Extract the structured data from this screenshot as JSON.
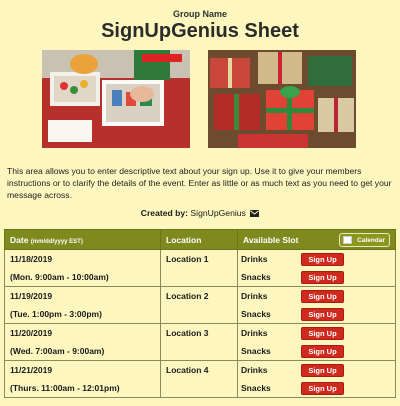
{
  "header": {
    "group_name": "Group Name",
    "title": "SignUpGenius Sheet"
  },
  "description": "This area allows you to enter descriptive text about your sign up. Use it to give your members instructions or to clarify the details of the event. Enter as little or as much text as you need to get your message across.",
  "created_by": {
    "label": "Created by:",
    "name": "SignUpGenius"
  },
  "table": {
    "col_date": "Date",
    "col_date_format": "(mm/dd/yyyy EST)",
    "col_location": "Location",
    "col_slot": "Available Slot",
    "calendar_label": "Calendar",
    "rows": [
      {
        "date": "11/18/2019",
        "time": "(Mon. 9:00am - 10:00am)",
        "location": "Location 1",
        "slots": [
          {
            "name": "Drinks",
            "button": "Sign Up"
          },
          {
            "name": "Snacks",
            "button": "Sign Up"
          }
        ]
      },
      {
        "date": "11/19/2019",
        "time": "(Tue. 1:00pm - 3:00pm)",
        "location": "Location 2",
        "slots": [
          {
            "name": "Drinks",
            "button": "Sign Up"
          },
          {
            "name": "Snacks",
            "button": "Sign Up"
          }
        ]
      },
      {
        "date": "11/20/2019",
        "time": "(Wed. 7:00am - 9:00am)",
        "location": "Location 3",
        "slots": [
          {
            "name": "Drinks",
            "button": "Sign Up"
          },
          {
            "name": "Snacks",
            "button": "Sign Up"
          }
        ]
      },
      {
        "date": "11/21/2019",
        "time": "(Thurs. 11:00am - 12:01pm)",
        "location": "Location 4",
        "slots": [
          {
            "name": "Drinks",
            "button": "Sign Up"
          },
          {
            "name": "Snacks",
            "button": "Sign Up"
          }
        ]
      }
    ]
  },
  "colors": {
    "background": "#fdf7bf",
    "header_bar": "#7e8a1e",
    "signup_button": "#d0291e"
  }
}
